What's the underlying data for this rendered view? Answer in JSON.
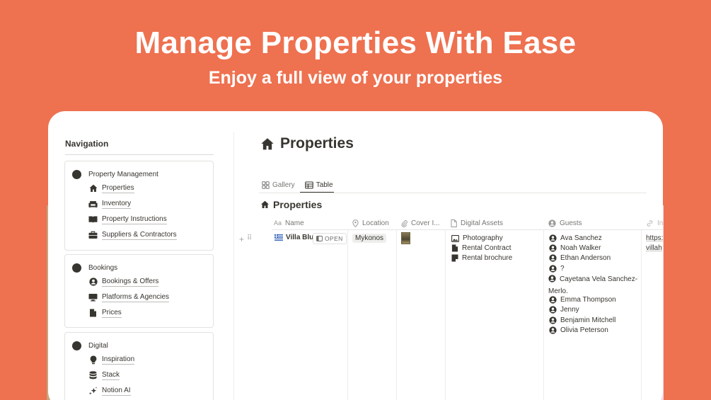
{
  "hero": {
    "title": "Manage Properties With Ease",
    "subtitle": "Enjoy a full view of your properties"
  },
  "navigation": {
    "title": "Navigation",
    "groups": [
      {
        "label": "Property Management",
        "items": [
          "Properties",
          "Inventory",
          "Property Instructions",
          "Suppliers & Contractors"
        ]
      },
      {
        "label": "Bookings",
        "items": [
          "Bookings & Offers",
          "Platforms & Agencies",
          "Prices"
        ]
      },
      {
        "label": "Digital",
        "items": [
          "Inspiration",
          "Stack",
          "Notion AI"
        ]
      }
    ]
  },
  "page": {
    "title": "Properties",
    "views": [
      "Gallery",
      "Table"
    ],
    "active_view": "Table",
    "database_title": "Properties"
  },
  "table": {
    "columns": [
      "Name",
      "Location",
      "Cover I...",
      "Digital Assets",
      "Guests",
      "In"
    ],
    "row": {
      "name": "Villa Blue",
      "open_label": "OPEN",
      "location": "Mykonos",
      "digital_assets": [
        "Photography",
        "Rental Contract",
        "Rental brochure"
      ],
      "guests": [
        "Ava Sanchez",
        "Noah Walker",
        "Ethan Anderson",
        "?",
        "Cayetana Vela Sanchez-Merlo.",
        "Emma Thompson",
        "Jenny",
        "Benjamin Mitchell",
        "Olivia Peterson"
      ],
      "url_parts": [
        "https:",
        "villah"
      ]
    }
  },
  "colors": {
    "background": "#ee7150",
    "card": "#ffffff",
    "text": "#37352f",
    "muted": "#787774"
  }
}
